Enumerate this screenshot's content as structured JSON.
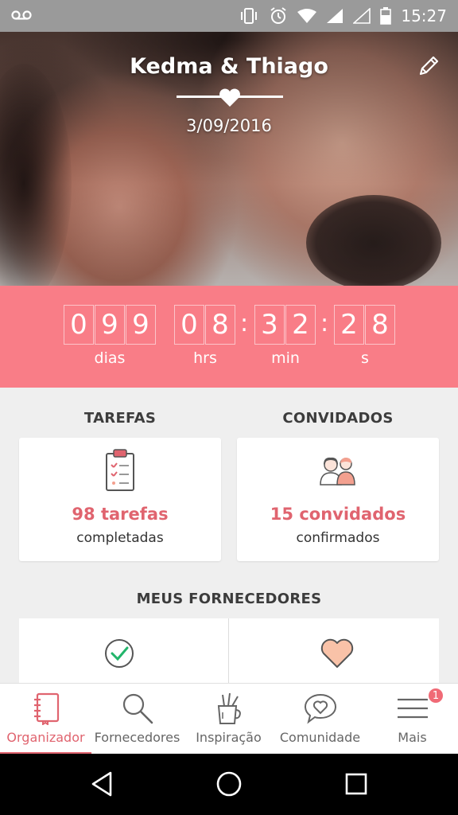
{
  "status_bar": {
    "time": "15:27",
    "background": "#9a9a9a"
  },
  "hero": {
    "title": "Kedma & Thiago",
    "date": "3/09/2016"
  },
  "countdown": {
    "background": "#f97d87",
    "days_digits": [
      "0",
      "9",
      "9"
    ],
    "hours_digits": [
      "0",
      "8"
    ],
    "minutes_digits": [
      "3",
      "2"
    ],
    "seconds_digits": [
      "2",
      "8"
    ],
    "separator": ":",
    "labels": {
      "days": "dias",
      "hours": "hrs",
      "minutes": "min",
      "seconds": "s"
    }
  },
  "tasks": {
    "title": "TAREFAS",
    "count": "98 tarefas",
    "subtitle": "completadas"
  },
  "guests": {
    "title": "CONVIDADOS",
    "count": "15 convidados",
    "subtitle": "confirmados"
  },
  "vendors": {
    "title": "MEUS FORNECEDORES"
  },
  "bottom_nav": {
    "accent": "#e0646f",
    "items": [
      {
        "label": "Organizador",
        "icon": "notebook-icon",
        "active": true
      },
      {
        "label": "Fornecedores",
        "icon": "search-icon"
      },
      {
        "label": "Inspiração",
        "icon": "pencil-cup-icon"
      },
      {
        "label": "Comunidade",
        "icon": "chat-heart-icon"
      },
      {
        "label": "Mais",
        "icon": "menu-icon"
      }
    ],
    "badge": "1"
  }
}
